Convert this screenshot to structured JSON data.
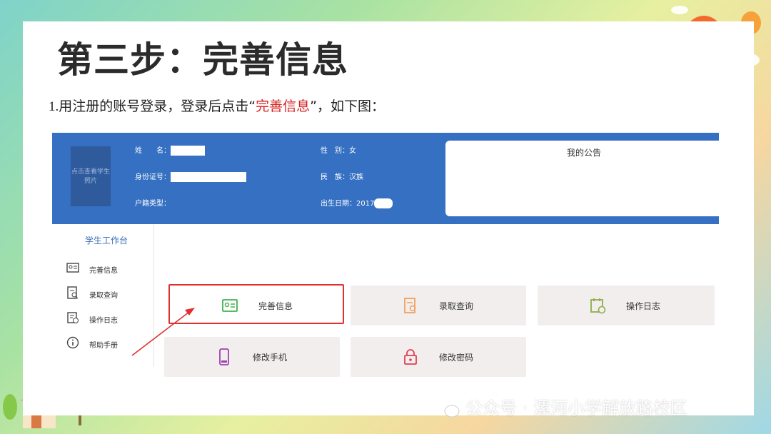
{
  "slide": {
    "title": "第三步：完善信息",
    "instruction": {
      "num": "1.",
      "before": "用注册的账号登录，登录后点击“",
      "highlight": "完善信息",
      "after": "”，如下图："
    }
  },
  "header": {
    "photo_text": "点击查看学生照片",
    "name_label": "姓　　名：",
    "id_label": "身份证号：",
    "hukou_label": "户籍类型：",
    "gender_label": "性　别：",
    "gender_value": "女",
    "ethnicity_label": "民　族：",
    "ethnicity_value": "汉族",
    "birth_label": "出生日期：",
    "birth_value": "2017",
    "notice_title": "我的公告"
  },
  "sidebar": {
    "heading": "学生工作台",
    "items": [
      {
        "label": "完善信息",
        "icon": "id-card-icon"
      },
      {
        "label": "录取查询",
        "icon": "document-search-icon"
      },
      {
        "label": "操作日志",
        "icon": "log-icon"
      },
      {
        "label": "帮助手册",
        "icon": "info-icon"
      }
    ]
  },
  "tiles": [
    {
      "label": "完善信息",
      "icon": "id-card-icon",
      "color": "#3fb34f",
      "selected": true
    },
    {
      "label": "录取查询",
      "icon": "document-search-icon",
      "color": "#f0a060"
    },
    {
      "label": "操作日志",
      "icon": "calendar-log-icon",
      "color": "#8fae48"
    },
    {
      "label": "修改手机",
      "icon": "phone-icon",
      "color": "#a040b0"
    },
    {
      "label": "修改密码",
      "icon": "lock-icon",
      "color": "#e04050"
    }
  ],
  "watermark": "公众号 · 漯河小学解放路校区",
  "colors": {
    "header_blue": "#3570c2",
    "highlight_red": "#d42020"
  }
}
